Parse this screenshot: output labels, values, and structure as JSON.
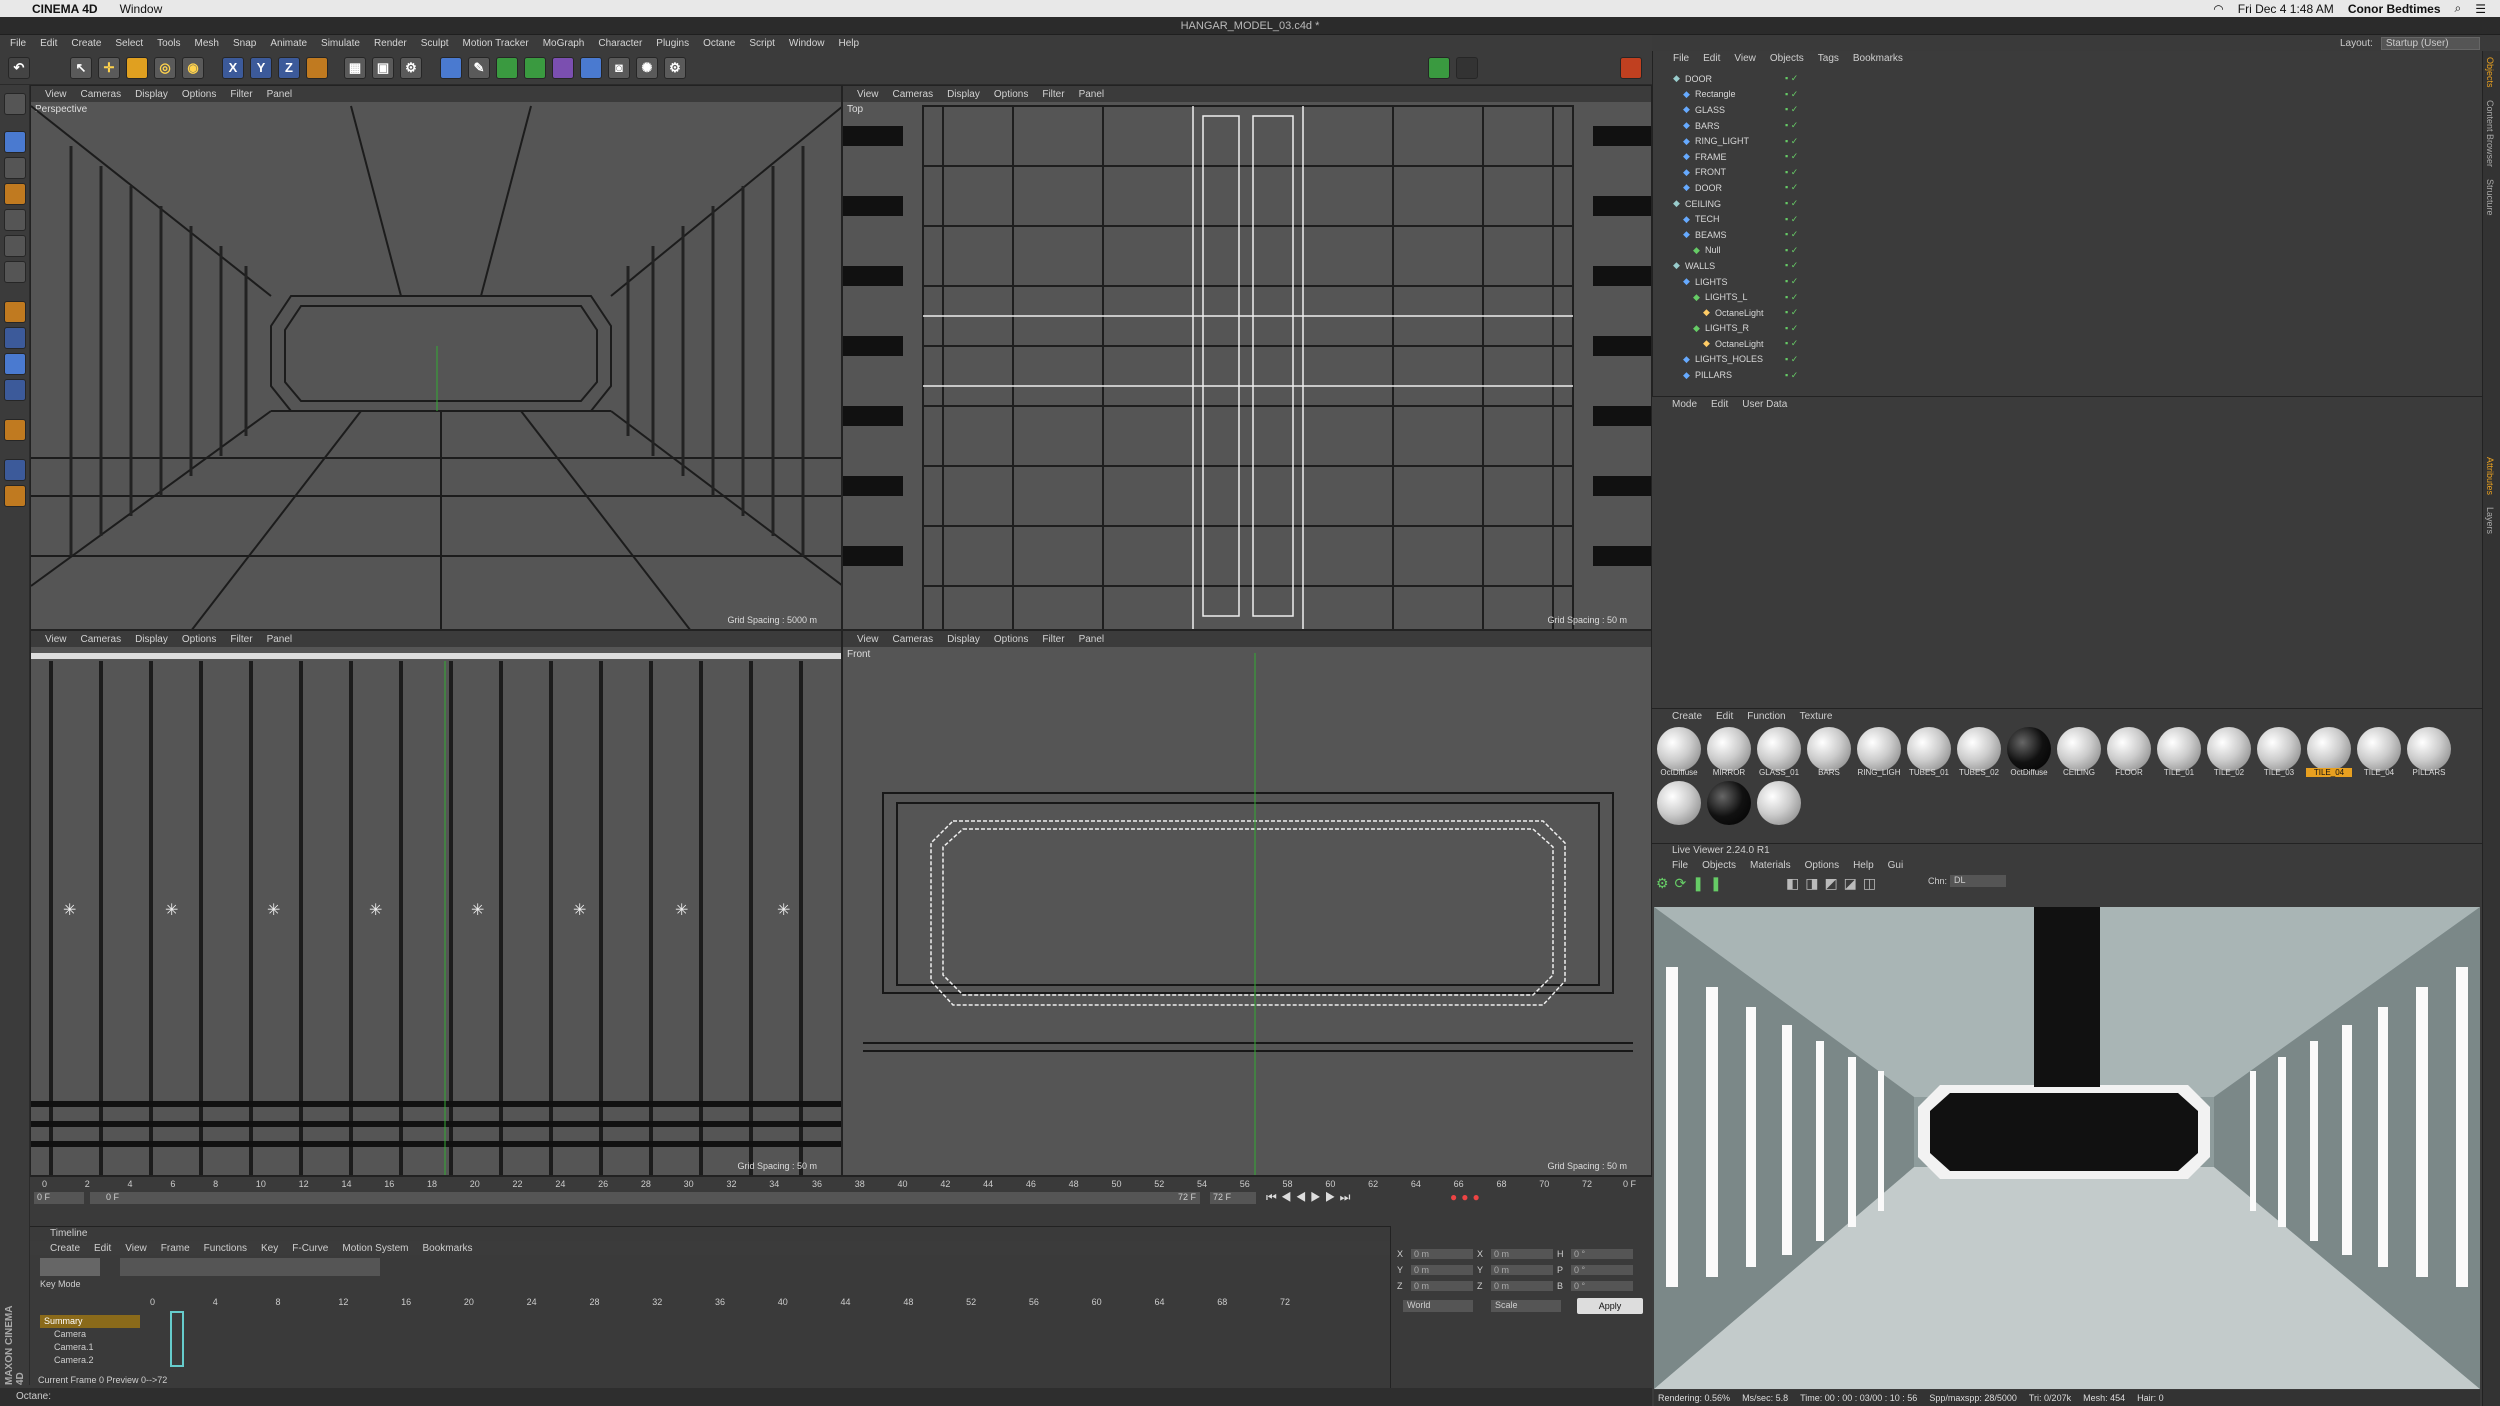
{
  "macbar": {
    "app": "CINEMA 4D",
    "menu": "Window",
    "datetime": "Fri Dec 4  1:48 AM",
    "user": "Conor Bedtimes"
  },
  "titlebar": {
    "file": "HANGAR_MODEL_03.c4d *"
  },
  "menu": [
    "File",
    "Edit",
    "Create",
    "Select",
    "Tools",
    "Mesh",
    "Snap",
    "Animate",
    "Simulate",
    "Render",
    "Sculpt",
    "Motion Tracker",
    "MoGraph",
    "Character",
    "Plugins",
    "Octane",
    "Script",
    "Window",
    "Help"
  ],
  "layout": {
    "label": "Layout:",
    "value": "Startup (User)"
  },
  "toolbar": {
    "x": "X",
    "y": "Y",
    "z": "Z"
  },
  "viewport_menu": [
    "View",
    "Cameras",
    "Display",
    "Options",
    "Filter",
    "Panel"
  ],
  "viewports": {
    "perspective": {
      "name": "Perspective",
      "grid": "Grid Spacing : 5000 m"
    },
    "top": {
      "name": "Top",
      "grid": "Grid Spacing : 50 m"
    },
    "right": {
      "name": "",
      "grid": "Grid Spacing : 50 m"
    },
    "front": {
      "name": "Front",
      "grid": "Grid Spacing : 50 m"
    }
  },
  "ruler": {
    "ticks": [
      "0",
      "2",
      "4",
      "6",
      "8",
      "10",
      "12",
      "14",
      "16",
      "18",
      "20",
      "22",
      "24",
      "26",
      "28",
      "30",
      "32",
      "34",
      "36",
      "38",
      "40",
      "42",
      "44",
      "46",
      "48",
      "50",
      "52",
      "54",
      "56",
      "58",
      "60",
      "62",
      "64",
      "66",
      "68",
      "70",
      "72"
    ],
    "frame_right": "0 F",
    "start": "0 F",
    "start2": "0 F",
    "end": "72 F",
    "end2": "72 F"
  },
  "timeline": {
    "title": "Timeline",
    "menu": [
      "Create",
      "Edit",
      "View",
      "Frame",
      "Functions",
      "Key",
      "F-Curve",
      "Motion System",
      "Bookmarks"
    ],
    "mode": "Key Mode",
    "ticks": [
      "0",
      "4",
      "8",
      "12",
      "16",
      "20",
      "24",
      "28",
      "32",
      "36",
      "40",
      "44",
      "48",
      "52",
      "56",
      "60",
      "64",
      "68",
      "72"
    ],
    "tracks": [
      "Summary",
      "Camera",
      "Camera.1",
      "Camera.2"
    ],
    "footer": "Current Frame  0  Preview  0-->72"
  },
  "coords": {
    "rows": [
      [
        "X",
        "0 m",
        "X",
        "0 m",
        "H",
        "0 °"
      ],
      [
        "Y",
        "0 m",
        "Y",
        "0 m",
        "P",
        "0 °"
      ],
      [
        "Z",
        "0 m",
        "Z",
        "0 m",
        "B",
        "0 °"
      ]
    ],
    "world": "World",
    "scale": "Scale",
    "apply": "Apply"
  },
  "status": "Octane:",
  "objects": {
    "menu": [
      "File",
      "Edit",
      "View",
      "Objects",
      "Tags",
      "Bookmarks"
    ],
    "items": [
      {
        "name": "DOOR",
        "indent": 0
      },
      {
        "name": "Rectangle",
        "indent": 1
      },
      {
        "name": "GLASS",
        "indent": 1
      },
      {
        "name": "BARS",
        "indent": 1
      },
      {
        "name": "RING_LIGHT",
        "indent": 1
      },
      {
        "name": "FRAME",
        "indent": 1
      },
      {
        "name": "FRONT",
        "indent": 1
      },
      {
        "name": "DOOR",
        "indent": 1
      },
      {
        "name": "CEILING",
        "indent": 0
      },
      {
        "name": "TECH",
        "indent": 1
      },
      {
        "name": "BEAMS",
        "indent": 1
      },
      {
        "name": "Null",
        "indent": 2
      },
      {
        "name": "WALLS",
        "indent": 0
      },
      {
        "name": "LIGHTS",
        "indent": 1
      },
      {
        "name": "LIGHTS_L",
        "indent": 2
      },
      {
        "name": "OctaneLight",
        "indent": 3
      },
      {
        "name": "LIGHTS_R",
        "indent": 2
      },
      {
        "name": "OctaneLight",
        "indent": 3
      },
      {
        "name": "LIGHTS_HOLES",
        "indent": 1
      },
      {
        "name": "PILLARS",
        "indent": 1
      }
    ]
  },
  "attributes": {
    "menu": [
      "Mode",
      "Edit",
      "User Data"
    ]
  },
  "materials": {
    "menu": [
      "Create",
      "Edit",
      "Function",
      "Texture"
    ],
    "items": [
      "OctDiffuse",
      "MIRROR",
      "GLASS_01",
      "BARS",
      "RING_LIGH",
      "TUBES_01",
      "TUBES_02",
      "OctDiffuse",
      "CEILING",
      "FLOOR",
      "TILE_01",
      "TILE_02",
      "TILE_03",
      "TILE_04",
      "TILE_04",
      "PILLARS",
      "",
      "",
      ""
    ],
    "selected": 13
  },
  "liveviewer": {
    "title": "Live Viewer 2.24.0 R1",
    "menu": [
      "File",
      "Objects",
      "Materials",
      "Options",
      "Help",
      "Gui"
    ],
    "chn_label": "Chn:",
    "chn": "DL",
    "status": [
      "Rendering: 0.56%",
      "Ms/sec: 5.8",
      "Time: 00 : 00 : 03/00 : 10 : 56",
      "Spp/maxspp: 28/5000",
      "Tri: 0/207k",
      "Mesh: 454",
      "Hair: 0"
    ]
  },
  "sidetabs": [
    "Objects",
    "Content Browser",
    "Structure",
    "Attributes",
    "Layers"
  ],
  "maxon": "MAXON CINEMA 4D"
}
